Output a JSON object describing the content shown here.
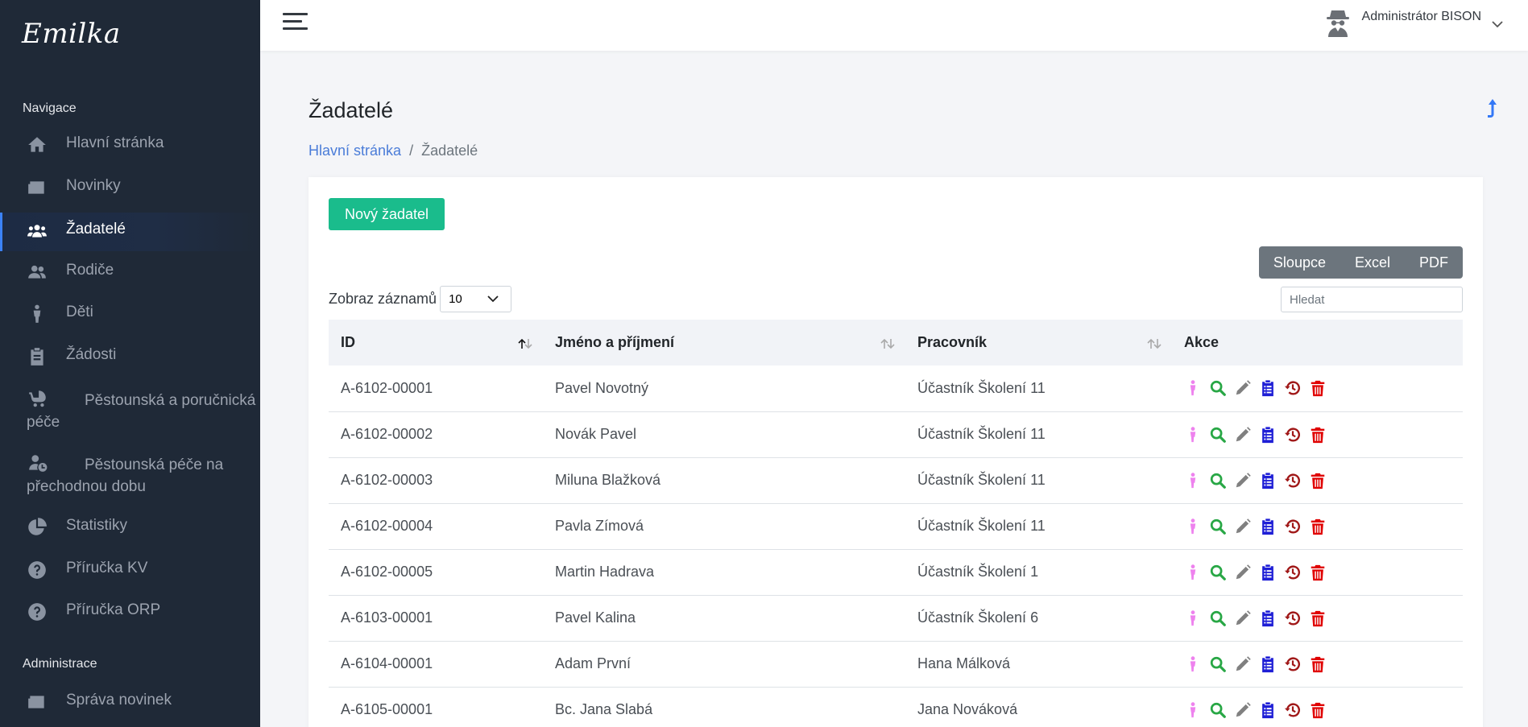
{
  "app": {
    "logo": "Emilka"
  },
  "sidebar": {
    "section_nav": "Navigace",
    "section_admin": "Administrace",
    "items": [
      {
        "label": "Hlavní stránka",
        "icon": "home-icon"
      },
      {
        "label": "Novinky",
        "icon": "newspaper-icon"
      },
      {
        "label": "Žadatelé",
        "icon": "users-icon",
        "active": true
      },
      {
        "label": "Rodiče",
        "icon": "user-group-icon"
      },
      {
        "label": "Děti",
        "icon": "child-icon"
      },
      {
        "label": "Žádosti",
        "icon": "clipboard-icon"
      },
      {
        "label_line1": "Pěstounská a poručnická",
        "label_line2": "péče",
        "icon": "stroller-icon"
      },
      {
        "label_line1": "Pěstounská péče na",
        "label_line2": "přechodnou dobu",
        "icon": "user-clock-icon"
      },
      {
        "label": "Statistiky",
        "icon": "pie-chart-icon"
      },
      {
        "label": "Příručka KV",
        "icon": "question-icon"
      },
      {
        "label": "Příručka ORP",
        "icon": "question-icon"
      }
    ],
    "admin_items": [
      {
        "label": "Správa novinek",
        "icon": "newspaper-icon"
      }
    ]
  },
  "topbar": {
    "user_name": "Administrátor BISON"
  },
  "page": {
    "title": "Žadatelé",
    "breadcrumb": {
      "home": "Hlavní stránka",
      "current": "Žadatelé",
      "separator": "/"
    }
  },
  "toolbar": {
    "new_button": "Nový žadatel",
    "export": {
      "columns": "Sloupce",
      "excel": "Excel",
      "pdf": "PDF"
    },
    "length_label": "Zobraz záznamů",
    "length_value": "10",
    "search_placeholder": "Hledat"
  },
  "table": {
    "headers": {
      "id": "ID",
      "name": "Jméno a příjmení",
      "worker": "Pracovník",
      "actions": "Akce"
    },
    "rows": [
      {
        "id": "A-6102-00001",
        "name": "Pavel Novotný",
        "worker": "Účastník Školení 11"
      },
      {
        "id": "A-6102-00002",
        "name": "Novák Pavel",
        "worker": "Účastník Školení 11"
      },
      {
        "id": "A-6102-00003",
        "name": "Miluna Blažková",
        "worker": "Účastník Školení 11"
      },
      {
        "id": "A-6102-00004",
        "name": "Pavla Zímová",
        "worker": "Účastník Školení 11"
      },
      {
        "id": "A-6102-00005",
        "name": "Martin Hadrava",
        "worker": "Účastník Školení 1"
      },
      {
        "id": "A-6103-00001",
        "name": "Pavel Kalina",
        "worker": "Účastník Školení 6"
      },
      {
        "id": "A-6104-00001",
        "name": "Adam První",
        "worker": "Hana Málková"
      },
      {
        "id": "A-6105-00001",
        "name": "Bc. Jana Slabá",
        "worker": "Jana Nováková"
      }
    ],
    "action_icons": [
      {
        "icon": "child-icon",
        "color": "#ee82ee"
      },
      {
        "icon": "search-icon",
        "color": "#28a745"
      },
      {
        "icon": "pencil-icon",
        "color": "#808080"
      },
      {
        "icon": "clipboard-list-icon",
        "color": "#1f1fd6"
      },
      {
        "icon": "history-icon",
        "color": "#a01818"
      },
      {
        "icon": "trash-icon",
        "color": "#e00000"
      }
    ]
  },
  "colors": {
    "sidebar_bg": "#1f2937",
    "accent": "#1abc8c",
    "link": "#4a7cd8"
  }
}
